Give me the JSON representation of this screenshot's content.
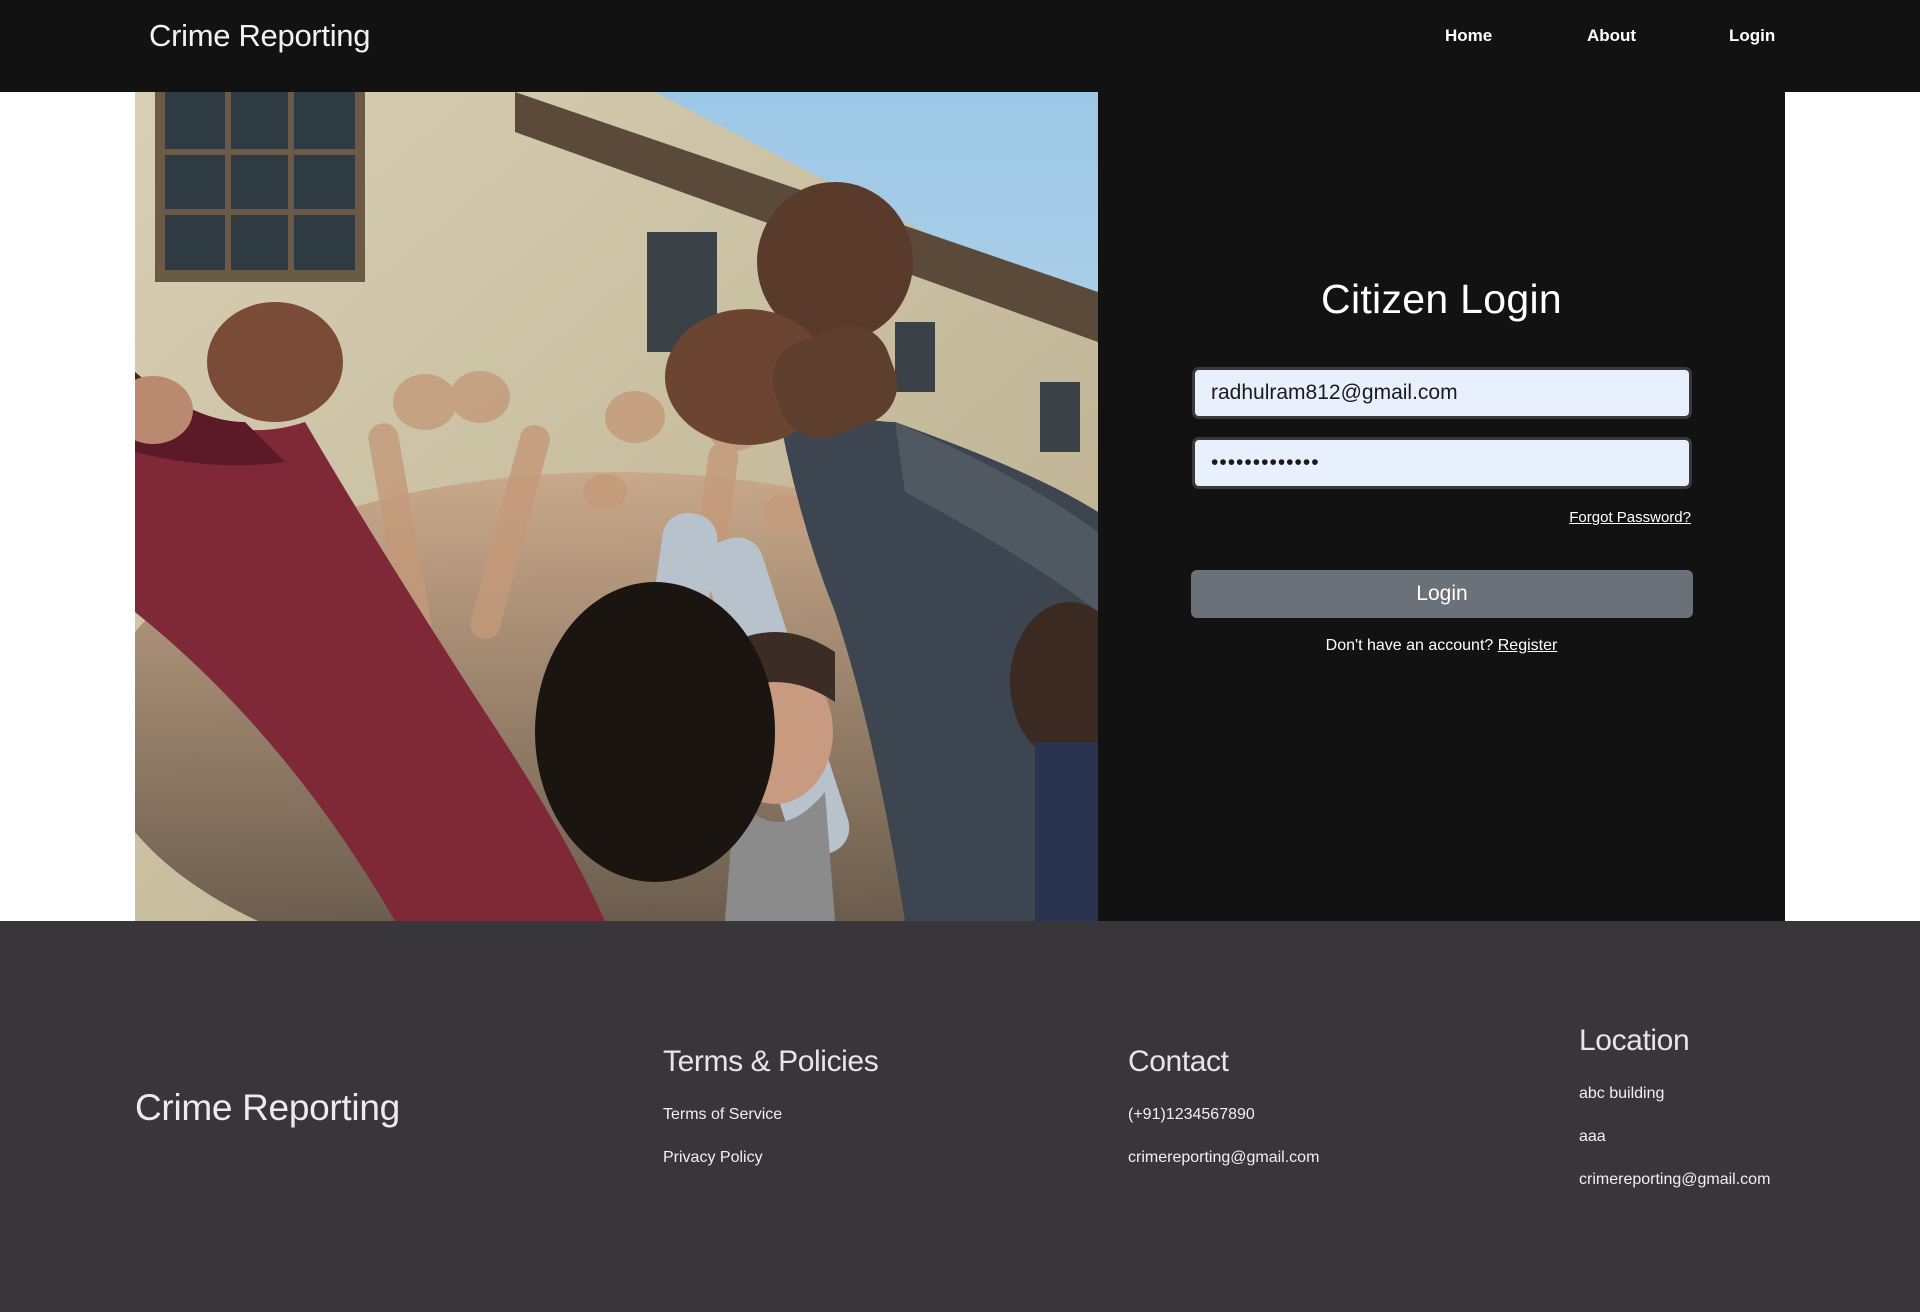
{
  "colors": {
    "navbar_bg": "#121212",
    "panel_bg": "#121212",
    "footer_bg": "#38363b",
    "input_bg": "#e8f0fe",
    "button_bg": "#6b7178"
  },
  "nav": {
    "brand": "Crime Reporting",
    "links": [
      "Home",
      "About",
      "Login"
    ]
  },
  "hero": {
    "image": "protest-raised-fists-photo"
  },
  "login": {
    "title": "Citizen Login",
    "email_value": "radhulram812@gmail.com",
    "password_value": "•••••••••••••",
    "forgot_label": "Forgot Password?",
    "button_label": "Login",
    "no_account_text": "Don't have an account?",
    "register_label": "Register"
  },
  "footer": {
    "brand": "Crime Reporting",
    "terms": {
      "heading": "Terms & Policies",
      "items": [
        "Terms of Service",
        "Privacy Policy"
      ]
    },
    "contact": {
      "heading": "Contact",
      "items": [
        "(+91)1234567890",
        "crimereporting@gmail.com"
      ]
    },
    "location": {
      "heading": "Location",
      "items": [
        "abc building",
        "aaa",
        "crimereporting@gmail.com"
      ]
    }
  }
}
